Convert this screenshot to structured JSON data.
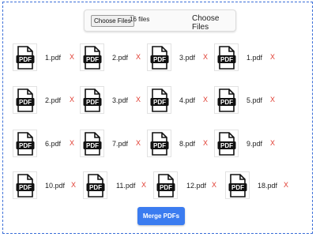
{
  "upload": {
    "choose_button": "Choose Files",
    "file_count": "16 files",
    "label": "Choose Files"
  },
  "files": [
    {
      "icon_label": "PDF",
      "name": "1.pdf",
      "remove": "X"
    },
    {
      "icon_label": "PDF",
      "name": "2.pdf",
      "remove": "X"
    },
    {
      "icon_label": "PDF",
      "name": "3.pdf",
      "remove": "X"
    },
    {
      "icon_label": "PDF",
      "name": "1.pdf",
      "remove": "X"
    },
    {
      "icon_label": "PDF",
      "name": "2.pdf",
      "remove": "X"
    },
    {
      "icon_label": "PDF",
      "name": "3.pdf",
      "remove": "X"
    },
    {
      "icon_label": "PDF",
      "name": "4.pdf",
      "remove": "X"
    },
    {
      "icon_label": "PDF",
      "name": "5.pdf",
      "remove": "X"
    },
    {
      "icon_label": "PDF",
      "name": "6.pdf",
      "remove": "X"
    },
    {
      "icon_label": "PDF",
      "name": "7.pdf",
      "remove": "X"
    },
    {
      "icon_label": "PDF",
      "name": "8.pdf",
      "remove": "X"
    },
    {
      "icon_label": "PDF",
      "name": "9.pdf",
      "remove": "X"
    },
    {
      "icon_label": "PDF",
      "name": "10.pdf",
      "remove": "X"
    },
    {
      "icon_label": "PDF",
      "name": "11.pdf",
      "remove": "X"
    },
    {
      "icon_label": "PDF",
      "name": "12.pdf",
      "remove": "X"
    },
    {
      "icon_label": "PDF",
      "name": "18.pdf",
      "remove": "X"
    }
  ],
  "merge_button": "Merge PDFs",
  "colors": {
    "accent": "#3b7cf0",
    "remove": "#e03a2f",
    "border": "#3b6fd8"
  }
}
